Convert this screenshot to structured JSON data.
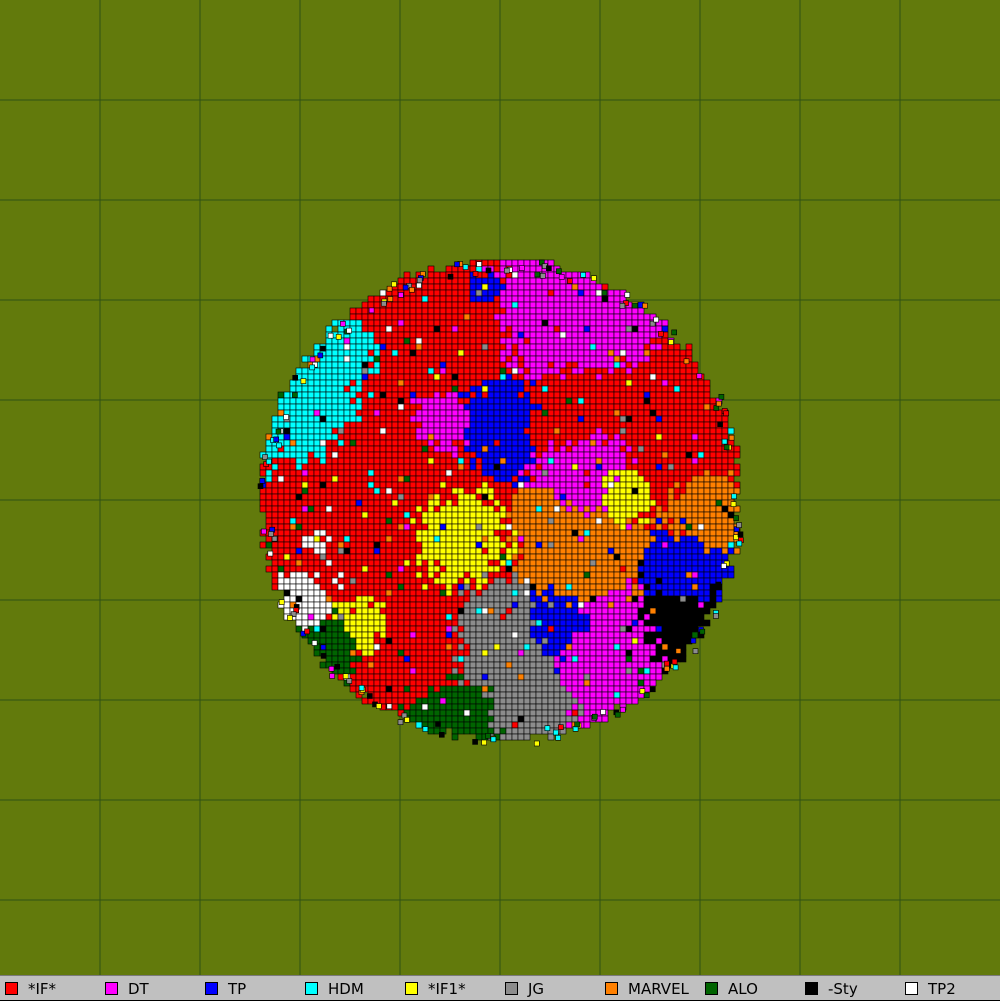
{
  "map": {
    "background_color": "#627a0c",
    "grid_color": "#2f5114",
    "outline_color": "#000000"
  },
  "legend": [
    {
      "name": "*IF*",
      "color": "#ff0000"
    },
    {
      "name": "DT",
      "color": "#ff00ff"
    },
    {
      "name": "TP",
      "color": "#0000ff"
    },
    {
      "name": "HDM",
      "color": "#00ffff"
    },
    {
      "name": "*IF1*",
      "color": "#ffff00"
    },
    {
      "name": "JG",
      "color": "#8c8c8c"
    },
    {
      "name": "MARVEL",
      "color": "#ff8000"
    },
    {
      "name": "ALO",
      "color": "#006400"
    },
    {
      "name": "-Sty",
      "color": "#000000"
    },
    {
      "name": "TP2",
      "color": "#ffffff"
    }
  ]
}
